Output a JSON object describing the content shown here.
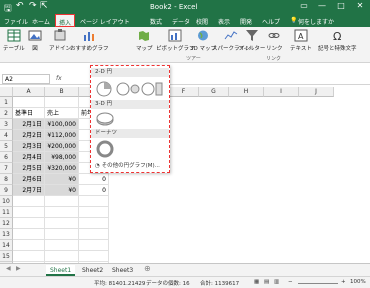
{
  "window": {
    "title": "Book2 - Excel"
  },
  "tabs": [
    "ファイル",
    "ホーム",
    "挿入",
    "ページ レイアウト",
    "数式",
    "データ",
    "校閲",
    "表示",
    "開発",
    "ヘルプ"
  ],
  "tell_me": "何をしますか",
  "ribbon": {
    "items": [
      "テーブル",
      "図",
      "アドイン",
      "おすすめグラフ",
      "マップ",
      "ピボットグラフ",
      "3D マップ",
      "スパークライン",
      "フィルター",
      "リンク",
      "テキスト",
      "記号と特殊文字"
    ],
    "groups": [
      "ツアー",
      "リンク"
    ]
  },
  "namebox": "A2",
  "fx_label": "fx",
  "columns": [
    "A",
    "B",
    "C",
    "D",
    "E",
    "F",
    "G",
    "H",
    "I",
    "J"
  ],
  "rows": [
    {
      "num": "1",
      "a": "",
      "b": "",
      "c": ""
    },
    {
      "num": "2",
      "a": "基準日",
      "b": "売上",
      "c": "前年"
    },
    {
      "num": "3",
      "a": "2月1日",
      "b": "¥100,000",
      "c": ""
    },
    {
      "num": "4",
      "a": "2月2日",
      "b": "¥112,000",
      "c": ""
    },
    {
      "num": "5",
      "a": "2月3日",
      "b": "¥200,000",
      "c": ""
    },
    {
      "num": "6",
      "a": "2月4日",
      "b": "¥98,000",
      "c": ""
    },
    {
      "num": "7",
      "a": "2月5日",
      "b": "¥320,000",
      "c": ""
    },
    {
      "num": "8",
      "a": "2月6日",
      "b": "¥0",
      "c": "0"
    },
    {
      "num": "9",
      "a": "2月7日",
      "b": "¥0",
      "c": "0"
    },
    {
      "num": "10",
      "a": "",
      "b": "",
      "c": ""
    },
    {
      "num": "11",
      "a": "",
      "b": "",
      "c": ""
    },
    {
      "num": "12",
      "a": "",
      "b": "",
      "c": ""
    },
    {
      "num": "13",
      "a": "",
      "b": "",
      "c": ""
    },
    {
      "num": "14",
      "a": "",
      "b": "",
      "c": ""
    },
    {
      "num": "15",
      "a": "",
      "b": "",
      "c": ""
    },
    {
      "num": "16",
      "a": "",
      "b": "",
      "c": ""
    }
  ],
  "pie_dropdown": {
    "section_2d": "2-D 円",
    "section_3d": "3-D 円",
    "section_donut": "ドーナツ",
    "more": "その他の円グラフ(M)..."
  },
  "sheets": [
    "Sheet1",
    "Sheet2",
    "Sheet3"
  ],
  "status": {
    "average": "平均: 81401.21429",
    "count": "データの個数: 16",
    "sum": "合計: 1139617",
    "zoom": "100%"
  },
  "colors": {
    "excel_green": "#217346",
    "highlight": "#e33"
  }
}
